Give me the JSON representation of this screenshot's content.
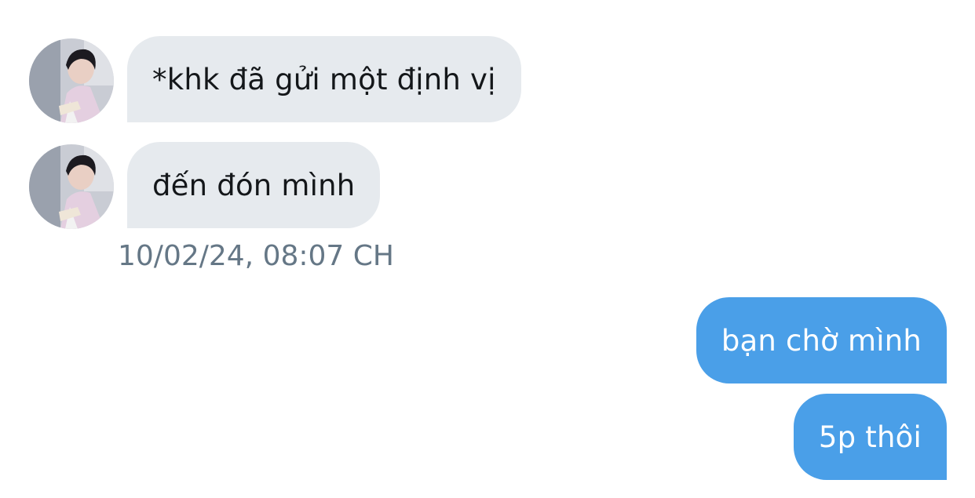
{
  "conversation": {
    "incoming": [
      {
        "text": "*khk đã gửi một định vị",
        "avatar_icon": "user-avatar"
      },
      {
        "text": "đến đón mình",
        "avatar_icon": "user-avatar"
      }
    ],
    "timestamp": "10/02/24, 08:07 CH",
    "outgoing": [
      {
        "text": "bạn chờ mình"
      },
      {
        "text": "5p thôi"
      }
    ]
  },
  "colors": {
    "incoming_bubble": "#e6eaee",
    "outgoing_bubble": "#4a9fe8",
    "timestamp_text": "#657786"
  }
}
